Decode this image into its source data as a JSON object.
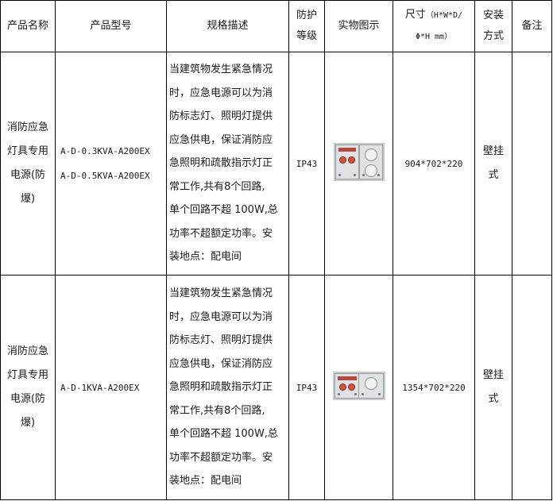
{
  "header": {
    "name": "产品名称",
    "model": "产品型号",
    "desc": "规格描述",
    "protect_1": "防护",
    "protect_2": "等级",
    "photo": "实物图示",
    "size_1": "尺寸",
    "size_1b": "（H*W*D/",
    "size_2": "Φ*H mm）",
    "mount_1": "安装",
    "mount_2": "方式",
    "note": "备注"
  },
  "rows": [
    {
      "name_lines": [
        "消防应急",
        "灯具专用",
        "电源(防",
        "爆)"
      ],
      "models": [
        "A-D-0.3KVA-A200EX",
        "A-D-0.5KVA-A200EX"
      ],
      "desc_lines": [
        "当建筑物发生紧急情况",
        "时，应急电源可以为消",
        "防标志灯、照明灯提供",
        "应急供电，保证消防应",
        "急照明和疏散指示灯正",
        "常工作,共有8个回路,",
        "单个回路不超 100W,总",
        "功率不超额定功率。安",
        "装地点：配电间"
      ],
      "ip": "IP43",
      "size": "904*702*220",
      "mount_lines": [
        "壁挂",
        "式"
      ],
      "note": ""
    },
    {
      "name_lines": [
        "消防应急",
        "灯具专用",
        "电源(防",
        "爆)"
      ],
      "models": [
        "A-D-1KVA-A200EX"
      ],
      "desc_lines": [
        "当建筑物发生紧急情况",
        "时，应急电源可以为消",
        "防标志灯、照明灯提供",
        "应急供电，保证消防应",
        "急照明和疏散指示灯正",
        "常工作,共有8个回路,",
        "单个回路不超 100W,总",
        "功率不超额定功率。安",
        "装地点：配电间"
      ],
      "ip": "IP43",
      "size": "1354*702*220",
      "mount_lines": [
        "壁挂",
        "式"
      ],
      "note": ""
    }
  ]
}
